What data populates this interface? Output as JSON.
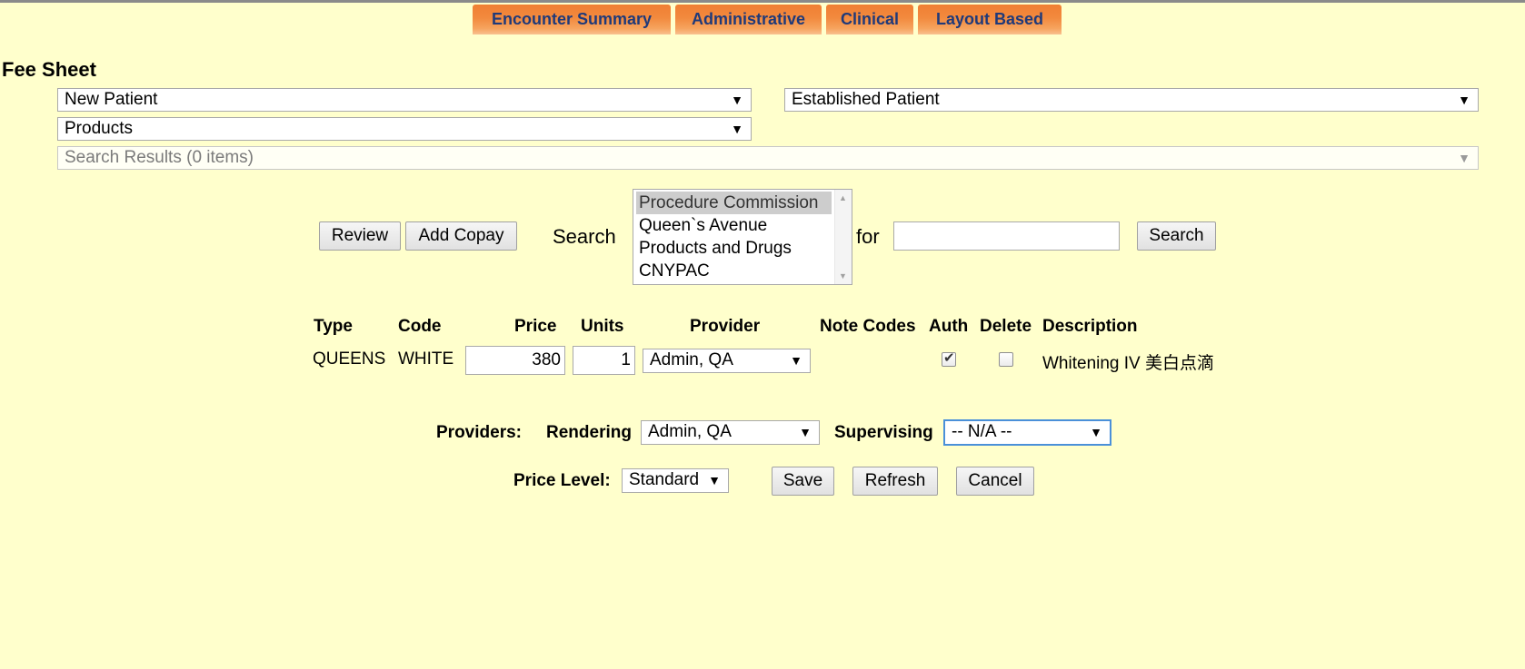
{
  "tabs": [
    {
      "label": "Encounter Summary"
    },
    {
      "label": "Administrative"
    },
    {
      "label": "Clinical"
    },
    {
      "label": "Layout Based"
    }
  ],
  "page_title": "Fee Sheet",
  "category_selects": {
    "new_patient": "New Patient",
    "established_patient": "Established Patient",
    "products": "Products",
    "search_results": "Search Results (0 items)"
  },
  "search_bar": {
    "review_label": "Review",
    "add_copay_label": "Add Copay",
    "search_label": "Search",
    "for_label": "for",
    "search_value": "",
    "search_button_label": "Search",
    "code_types": [
      {
        "label": "Procedure Commission",
        "selected": true
      },
      {
        "label": "Queen`s Avenue",
        "selected": false
      },
      {
        "label": "Products and Drugs",
        "selected": false
      },
      {
        "label": "CNYPAC",
        "selected": false
      }
    ]
  },
  "table": {
    "headers": {
      "type": "Type",
      "code": "Code",
      "price": "Price",
      "units": "Units",
      "provider": "Provider",
      "note_codes": "Note Codes",
      "auth": "Auth",
      "delete": "Delete",
      "description": "Description"
    },
    "rows": [
      {
        "type": "QUEENS",
        "code": "WHITE",
        "price": "380",
        "units": "1",
        "provider": "Admin, QA",
        "auth": true,
        "delete": false,
        "description": "Whitening IV 美白点滴"
      }
    ]
  },
  "providers": {
    "label": "Providers:",
    "rendering_label": "Rendering",
    "rendering_value": "Admin, QA",
    "supervising_label": "Supervising",
    "supervising_value": "-- N/A --"
  },
  "footer": {
    "price_level_label": "Price Level:",
    "price_level_value": "Standard",
    "save_label": "Save",
    "refresh_label": "Refresh",
    "cancel_label": "Cancel"
  },
  "icons": {
    "dropdown": "▼",
    "check": "✔",
    "scroll_up": "▲",
    "scroll_down": "▼"
  }
}
